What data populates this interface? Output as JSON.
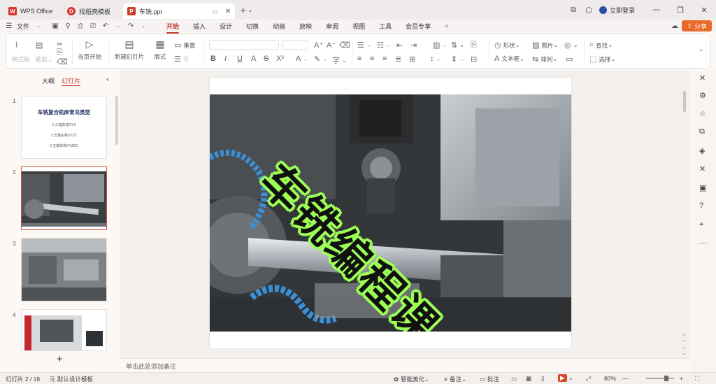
{
  "tabs": [
    {
      "label": "WPS Office",
      "logo": "W",
      "logo_color": "#d6332b"
    },
    {
      "label": "找稻壳模板",
      "logo": "D",
      "logo_color": "#d6332b"
    },
    {
      "label": "车铣.ppt",
      "logo": "P",
      "logo_color": "#c7402d"
    }
  ],
  "window": {
    "login_label": "立即登录"
  },
  "menu": {
    "file_label": "文件",
    "items": [
      "开始",
      "插入",
      "设计",
      "切换",
      "动画",
      "放映",
      "审阅",
      "视图",
      "工具",
      "会员专享"
    ],
    "active_index": 0,
    "share_label": "分享"
  },
  "ribbon": {
    "format_painter": "格式刷",
    "paste": "粘贴",
    "from_current": "当页开始",
    "new_slide": "新建幻灯片",
    "layout": "版式",
    "reset": "重置",
    "section": "节",
    "shape": "形状",
    "picture": "图片",
    "textbox": "文本框",
    "arrange": "排列",
    "find": "查找",
    "select": "选择"
  },
  "left_panel": {
    "tab_outline": "大纲",
    "tab_slides": "幻灯片",
    "slides": [
      {
        "num": "1",
        "title": "车铣复合机床常见类型",
        "lines": [
          "1.三轴车铣XYZ",
          "2.五轴车铣XYZC",
          "3.五轴车铣XYZBC"
        ]
      },
      {
        "num": "2"
      },
      {
        "num": "3"
      },
      {
        "num": "4"
      }
    ]
  },
  "slide": {
    "title": "车铣编程课"
  },
  "notes": {
    "placeholder": "单击此处添加备注"
  },
  "status": {
    "slide_counter": "幻灯片 2 / 18",
    "template": "默认设计模板",
    "beautify": "智能美化",
    "notes": "备注",
    "comments": "批注",
    "zoom": "80%"
  },
  "colors": {
    "accent": "#c93c31",
    "share": "#e8692a",
    "title_glow": "#9dff55"
  }
}
